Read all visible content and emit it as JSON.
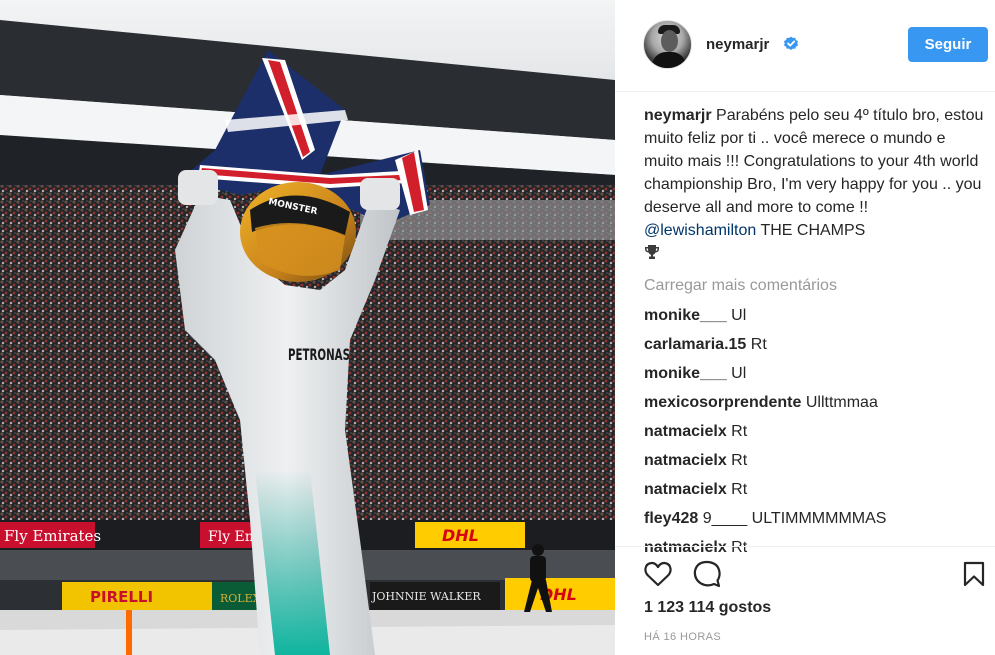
{
  "post": {
    "author": "neymarjr",
    "follow_label": "Seguir",
    "caption_user": "neymarjr",
    "caption_text": "Parabéns pelo seu 4º título bro, estou muito feliz por ti .. você merece o mundo e muito mais !!! Congratulations to your 4th world championship Bro, I'm very happy for you .. you deserve all and more to come !! ",
    "caption_mention": "@lewishamilton",
    "caption_tail": " THE CHAMPS",
    "load_more_label": "Carregar mais comentários",
    "comments": [
      {
        "user": "monike___",
        "text": "Ul"
      },
      {
        "user": "carlamaria.15",
        "text": "Rt"
      },
      {
        "user": "monike___",
        "text": "Ul"
      },
      {
        "user": "mexicosorprendente",
        "text": "Ullttmmaa"
      },
      {
        "user": "natmacielx",
        "text": "Rt"
      },
      {
        "user": "natmacielx",
        "text": "Rt"
      },
      {
        "user": "natmacielx",
        "text": "Rt"
      },
      {
        "user": "fley428",
        "text": "9____ ULTIMMMMMMAS"
      },
      {
        "user": "natmacielx",
        "text": "Rt"
      }
    ],
    "likes_label": "1 123 114 gostos",
    "timestamp": "HÁ 16 HORAS"
  },
  "photo": {
    "signage": [
      "Fly Emirates",
      "Fly Emirates",
      "DHL",
      "DHL",
      "PIRELLI",
      "ROLEX",
      "JOHNNIE WALKER",
      "PETRONAS"
    ]
  },
  "colors": {
    "follow_button": "#3897f0",
    "verified_badge": "#3897f0",
    "mention": "#003569",
    "muted": "#999999"
  },
  "icons": {
    "like": "heart-outline-icon",
    "comment": "speech-bubble-icon",
    "save": "bookmark-icon",
    "verified": "verified-badge-icon",
    "trophy": "trophy-icon"
  }
}
